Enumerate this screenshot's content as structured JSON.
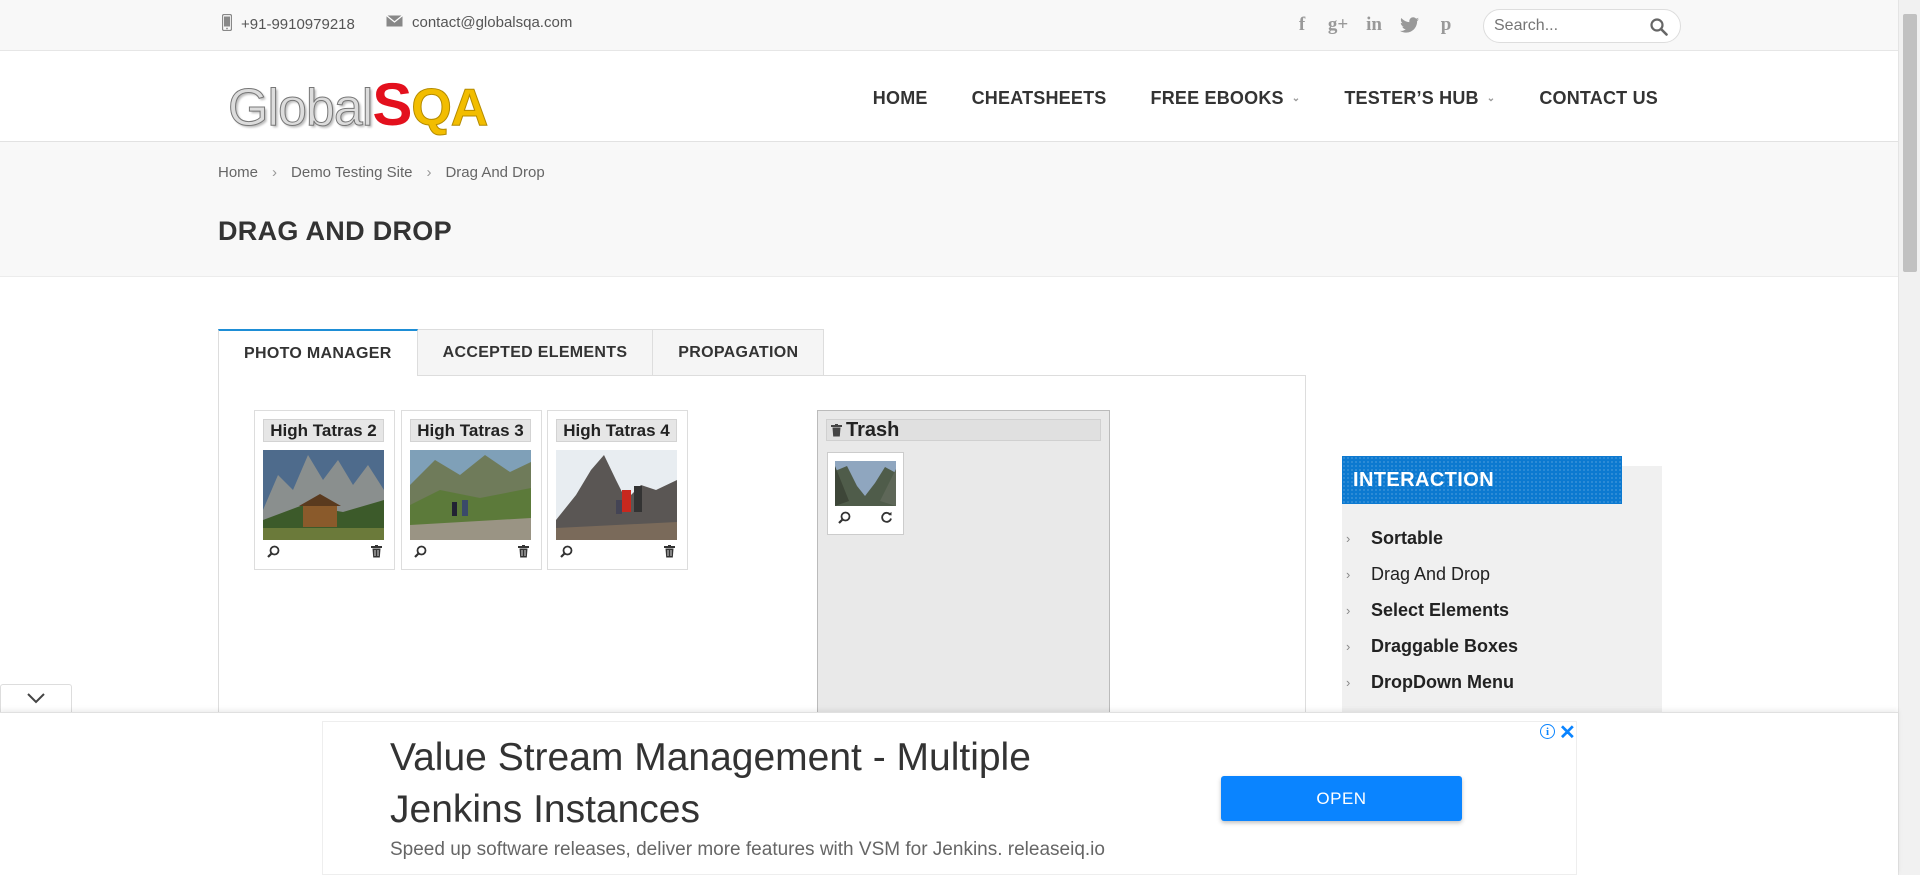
{
  "topbar": {
    "phone": "+91-9910979218",
    "email": "contact@globalsqa.com",
    "social": [
      {
        "name": "facebook-icon",
        "glyph": "f"
      },
      {
        "name": "google-plus-icon",
        "glyph": "g+"
      },
      {
        "name": "linkedin-icon",
        "glyph": "in"
      },
      {
        "name": "twitter-icon",
        "glyph": "t"
      },
      {
        "name": "pinterest-icon",
        "glyph": "p"
      }
    ],
    "search_placeholder": "Search..."
  },
  "logo": {
    "part1": "Global",
    "part2": "S",
    "part3": "QA"
  },
  "nav": {
    "home": "HOME",
    "cheatsheets": "CHEATSHEETS",
    "free_ebooks": "FREE EBOOKS",
    "testers_hub": "TESTER’S HUB",
    "contact_us": "CONTACT US"
  },
  "breadcrumb": {
    "home": "Home",
    "demo": "Demo Testing Site",
    "current": "Drag And Drop",
    "separator": "›"
  },
  "page_title": "DRAG AND DROP",
  "tabs": [
    "PHOTO MANAGER",
    "ACCEPTED ELEMENTS",
    "PROPAGATION"
  ],
  "gallery": [
    {
      "title": "High Tatras 2"
    },
    {
      "title": "High Tatras 3"
    },
    {
      "title": "High Tatras 4"
    }
  ],
  "trash": {
    "title": "Trash"
  },
  "sidebar": {
    "title": "INTERACTION",
    "items": [
      "Sortable",
      "Drag And Drop",
      "Select Elements",
      "Draggable Boxes",
      "DropDown Menu"
    ]
  },
  "ad": {
    "headline": "Value Stream Management - Multiple Jenkins Instances",
    "sub": "Speed up software releases, deliver more features with VSM for Jenkins. releaseiq.io",
    "button": "OPEN",
    "accent": "#0a84ff"
  },
  "colors": {
    "tab_accent": "#1e8ed6",
    "sidebar_header": "#0c79d0",
    "logo_red": "#e3101d",
    "logo_yellow": "#f2bd00"
  }
}
